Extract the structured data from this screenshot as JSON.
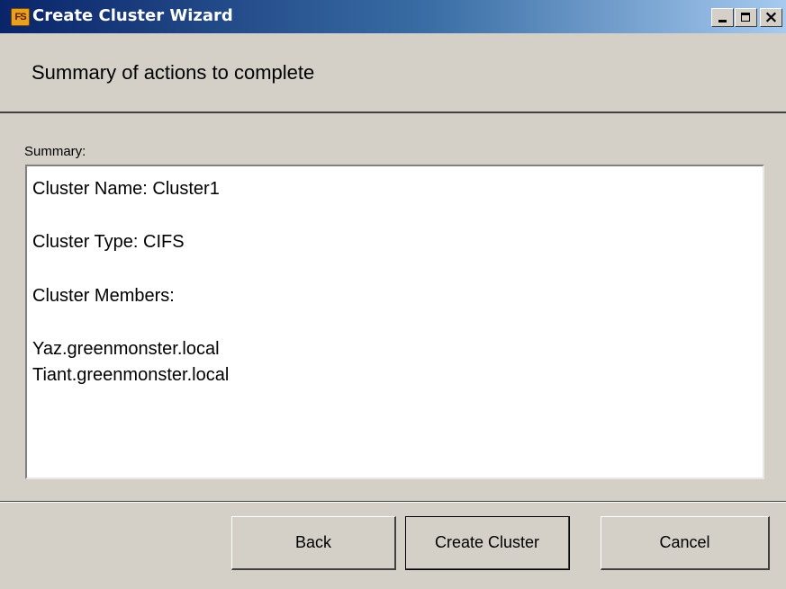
{
  "window": {
    "icon_text": "FS",
    "title": "Create Cluster Wizard",
    "close_glyph": "×"
  },
  "header": {
    "text": "Summary of actions to complete"
  },
  "summary": {
    "label": "Summary:",
    "lines": [
      "Cluster Name: Cluster1",
      "Cluster Type: CIFS",
      "Cluster Members:",
      "Yaz.greenmonster.local",
      "Tiant.greenmonster.local"
    ]
  },
  "buttons": {
    "back": "Back",
    "create": "Create Cluster",
    "cancel": "Cancel"
  },
  "colors": {
    "titlebar_start": "#0a246a",
    "titlebar_end": "#a6caf0",
    "dialog_bg": "#d4d0c8"
  }
}
